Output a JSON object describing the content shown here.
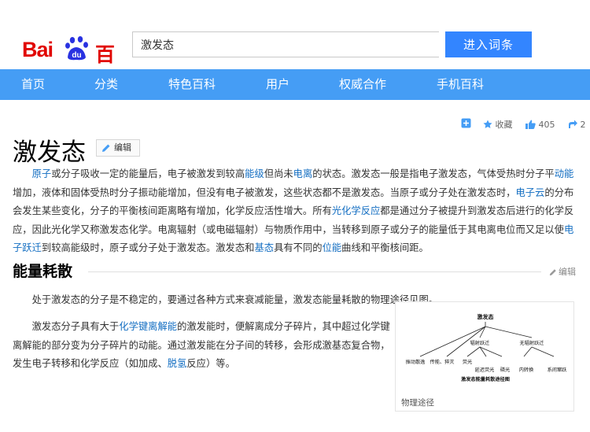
{
  "logo": {
    "part1": "Bai",
    "du": "du",
    "part2": "百科"
  },
  "search": {
    "value": "激发态",
    "button": "进入词条"
  },
  "nav": [
    "首页",
    "分类",
    "特色百科",
    "用户",
    "权威合作",
    "手机百科"
  ],
  "toolbar": {
    "collect": "收藏",
    "likes": "405",
    "share_count": "2"
  },
  "article": {
    "title": "激发态",
    "edit_label": "编辑",
    "intro": [
      {
        "t": "原子",
        "l": true
      },
      {
        "t": "或分子吸收一定的能量后，电子被激发到较高"
      },
      {
        "t": "能级",
        "l": true
      },
      {
        "t": "但尚未"
      },
      {
        "t": "电离",
        "l": true
      },
      {
        "t": "的状态。激发态一般是指电子激发态，气体受热时分子平"
      },
      {
        "t": "动能",
        "l": true
      },
      {
        "t": "增加，液体和固体受热时分子振动能增加，但没有电子被激发，这些状态都不是激发态。当原子或分子处在激发态时，"
      },
      {
        "t": "电子云",
        "l": true
      },
      {
        "t": "的分布会发生某些变化，分子的平衡核间距离略有增加，化学反应活性增大。所有"
      },
      {
        "t": "光化学反应",
        "l": true
      },
      {
        "t": "都是通过分子被提升到激发态后进行的化学反应，因此光化学又称激发态化学。电离辐射（或电磁辐射）与物质作用中，当转移到原子或分子的能量低于其电离电位而又足以使"
      },
      {
        "t": "电子跃迁",
        "l": true
      },
      {
        "t": "到较高能级时，原子或分子处于激发态。激发态和"
      },
      {
        "t": "基态",
        "l": true
      },
      {
        "t": "具有不同的"
      },
      {
        "t": "位能",
        "l": true
      },
      {
        "t": "曲线和平衡核间距。"
      }
    ]
  },
  "section": {
    "heading": "能量耗散",
    "edit_label": "编辑",
    "p1": "处于激发态的分子是不稳定的，要通过各种方式来衰减能量，激发态能量耗散的物理途径见图。",
    "p2": [
      {
        "t": "激发态分子具有大于"
      },
      {
        "t": "化学键离解能",
        "l": true
      },
      {
        "t": "的激发能时，便解离成分子碎片，其中超过化学键离解能的部分变为分子碎片的动能。通过激发能在分子间的转移，会形成激基态复合物，发生电子转移和化学反应（如加成、"
      },
      {
        "t": "脱氢",
        "l": true
      },
      {
        "t": "反应）等。"
      }
    ]
  },
  "figure": {
    "caption": "物理途径",
    "root": "激发态",
    "mid": [
      "辐射跃迁",
      "无辐射跃迁"
    ],
    "leaves": [
      "振动散逸",
      "传能、猝灭",
      "荧光",
      "延迟荧光",
      "磷光",
      "内转换",
      "系间窜跃"
    ],
    "bottom": "激发态能量耗散途径图"
  },
  "colors": {
    "brand_red": "#e10602",
    "nav_blue": "#459df5",
    "button_blue": "#3385ff",
    "link": "#136ec2"
  }
}
